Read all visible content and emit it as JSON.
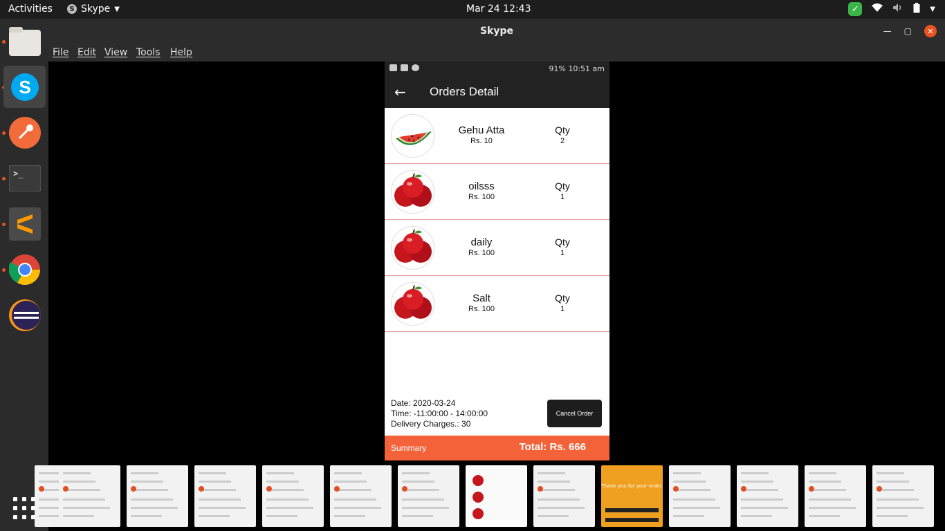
{
  "topbar": {
    "activities": "Activities",
    "app_name": "Skype",
    "clock": "Mar 24  12:43"
  },
  "dock": {
    "items": [
      "files",
      "skype",
      "postman",
      "terminal",
      "sublime-text",
      "chrome",
      "eclipse"
    ],
    "apps_grid": "show-applications"
  },
  "window": {
    "title": "Skype",
    "menu": [
      "File",
      "Edit",
      "View",
      "Tools",
      "Help"
    ]
  },
  "phone": {
    "status_left": "",
    "status_right": "91%  10:51 am",
    "screen_title": "Orders Detail",
    "orders": [
      {
        "name": "Gehu Atta",
        "price": "Rs. 10",
        "qty_label": "Qty",
        "qty": "2",
        "image": "watermelon"
      },
      {
        "name": "oilsss",
        "price": "Rs. 100",
        "qty_label": "Qty",
        "qty": "1",
        "image": "apples"
      },
      {
        "name": "daily",
        "price": "Rs. 100",
        "qty_label": "Qty",
        "qty": "1",
        "image": "apples"
      },
      {
        "name": "Salt",
        "price": "Rs. 100",
        "qty_label": "Qty",
        "qty": "1",
        "image": "apples"
      }
    ],
    "date": "Date: 2020-03-24",
    "time": "Time: -11:00:00 - 14:00:00",
    "delivery": "Delivery Charges.: 30",
    "cancel_label": "Cancel Order",
    "summary_label": "Summary",
    "total": "Total: Rs.  666"
  },
  "strip": {
    "thumbnails_count": 13,
    "orange_text": "Thank you for your order."
  },
  "colors": {
    "accent": "#f4623a",
    "ubuntu_orange": "#e95420",
    "dark_bar": "#222222"
  }
}
